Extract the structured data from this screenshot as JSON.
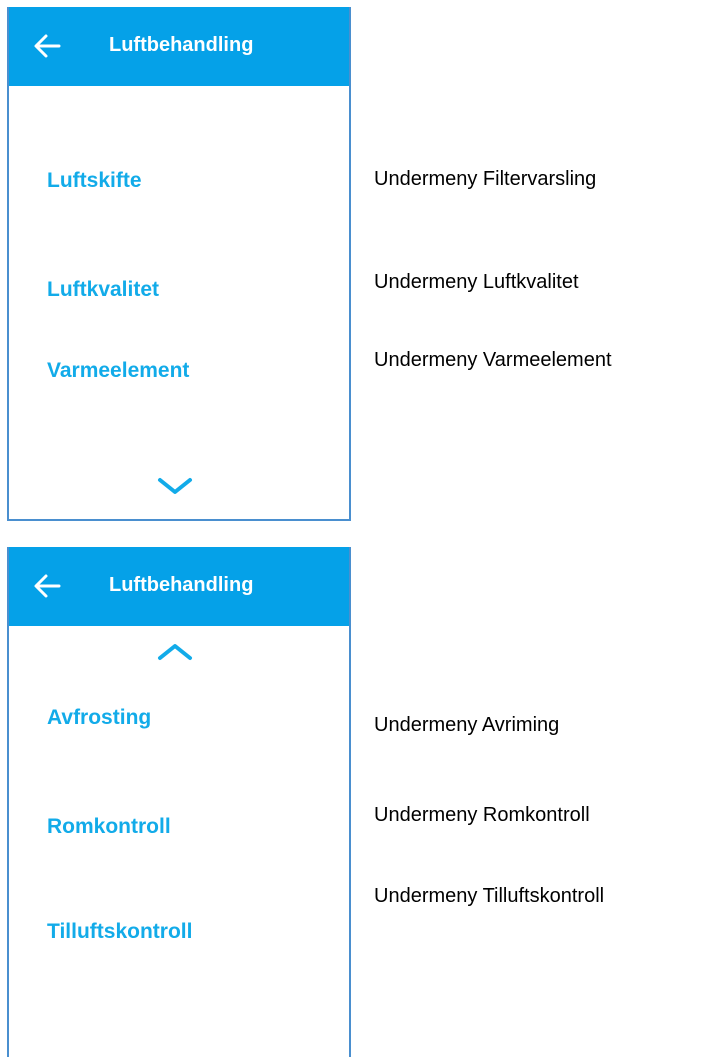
{
  "screens": [
    {
      "title": "Luftbehandling",
      "back_icon": "arrow-left-icon",
      "scroll_icon": "chevron-down-icon",
      "items": [
        {
          "label": "Luftskifte"
        },
        {
          "label": "Luftkvalitet"
        },
        {
          "label": "Varmeelement"
        }
      ]
    },
    {
      "title": "Luftbehandling",
      "back_icon": "arrow-left-icon",
      "scroll_icon": "chevron-up-icon",
      "items": [
        {
          "label": "Avfrosting"
        },
        {
          "label": "Romkontroll"
        },
        {
          "label": "Tilluftskontroll"
        }
      ]
    }
  ],
  "annotations": [
    "Undermeny Filtervarsling",
    "Undermeny Luftkvalitet",
    "Undermeny Varmeelement",
    "Undermeny Avriming",
    "Undermeny Romkontroll",
    "Undermeny Tilluftskontroll"
  ],
  "colors": {
    "header_bg": "#05a1e8",
    "accent": "#12abe9",
    "frame": "#4a8fcf"
  }
}
